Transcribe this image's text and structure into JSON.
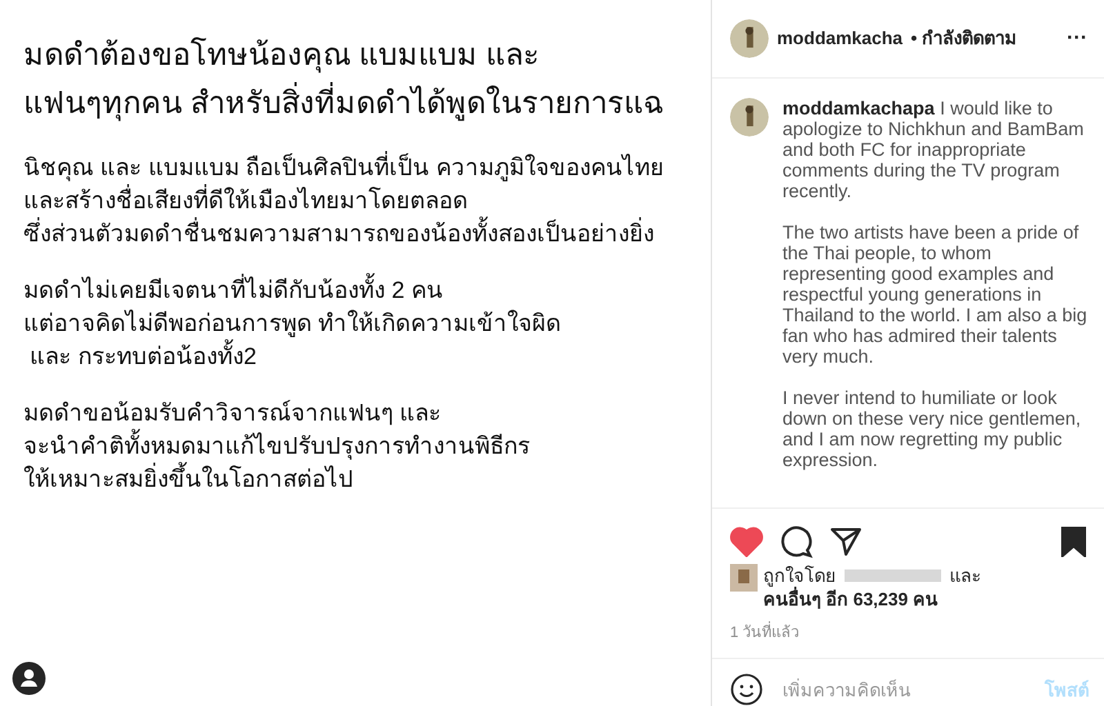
{
  "post_image": {
    "paragraphs": [
      {
        "kind": "heading",
        "lines": [
          "มดดำต้องขอโทษน้องคุณ แบมแบม และ",
          "แฟนๆทุกคน สำหรับสิ่งที่มดดำได้พูดในรายการแฉ"
        ]
      },
      {
        "kind": "body",
        "lines": [
          "นิชคุณ และ แบมแบม ถือเป็นศิลปินที่เป็น ความภูมิใจของคนไทย",
          "และสร้างชื่อเสียงที่ดีให้เมืองไทยมาโดยตลอด",
          "ซึ่งส่วนตัวมดดำชื่นชมความสามารถของน้องทั้งสองเป็นอย่างยิ่ง"
        ]
      },
      {
        "kind": "body",
        "lines": [
          "มดดำไม่เคยมีเจตนาที่ไม่ดีกับน้องทั้ง 2 คน",
          "แต่อาจคิดไม่ดีพอก่อนการพูด ทำให้เกิดความเข้าใจผิด",
          " และ กระทบต่อน้องทั้ง2"
        ]
      },
      {
        "kind": "body",
        "lines": [
          "มดดำขอน้อมรับคำวิจารณ์จากแฟนๆ และ",
          "จะนำคำติทั้งหมดมาแก้ไขปรับปรุงการทำงานพิธีกร",
          "ให้เหมาะสมยิ่งขึ้นในโอกาสต่อไป"
        ]
      }
    ]
  },
  "header": {
    "username": "moddamkacha",
    "status": "• กำลังติดตาม",
    "more": "···"
  },
  "caption": {
    "username": "moddamkachapa",
    "paragraphs": [
      "I would like to apologize to Nichkhun and BamBam and both FC for inappropriate comments during the TV program recently.",
      "The two artists have been a pride of the Thai people, to whom representing good examples and respectful young generations in Thailand to the world. I am also a big fan who has admired their talents very much.",
      "I never intend to humiliate or look down on these very nice gentlemen, and I am now regretting my public expression."
    ]
  },
  "actions": {
    "liked": true,
    "saved": true
  },
  "likes": {
    "prefix": "ถูกใจโดย",
    "suffix": "และ",
    "others": "คนอื่นๆ อีก 63,239 คน"
  },
  "time": "1 วันที่แล้ว",
  "comment": {
    "placeholder": "เพิ่มความคิดเห็น",
    "post": "โพสต์"
  }
}
